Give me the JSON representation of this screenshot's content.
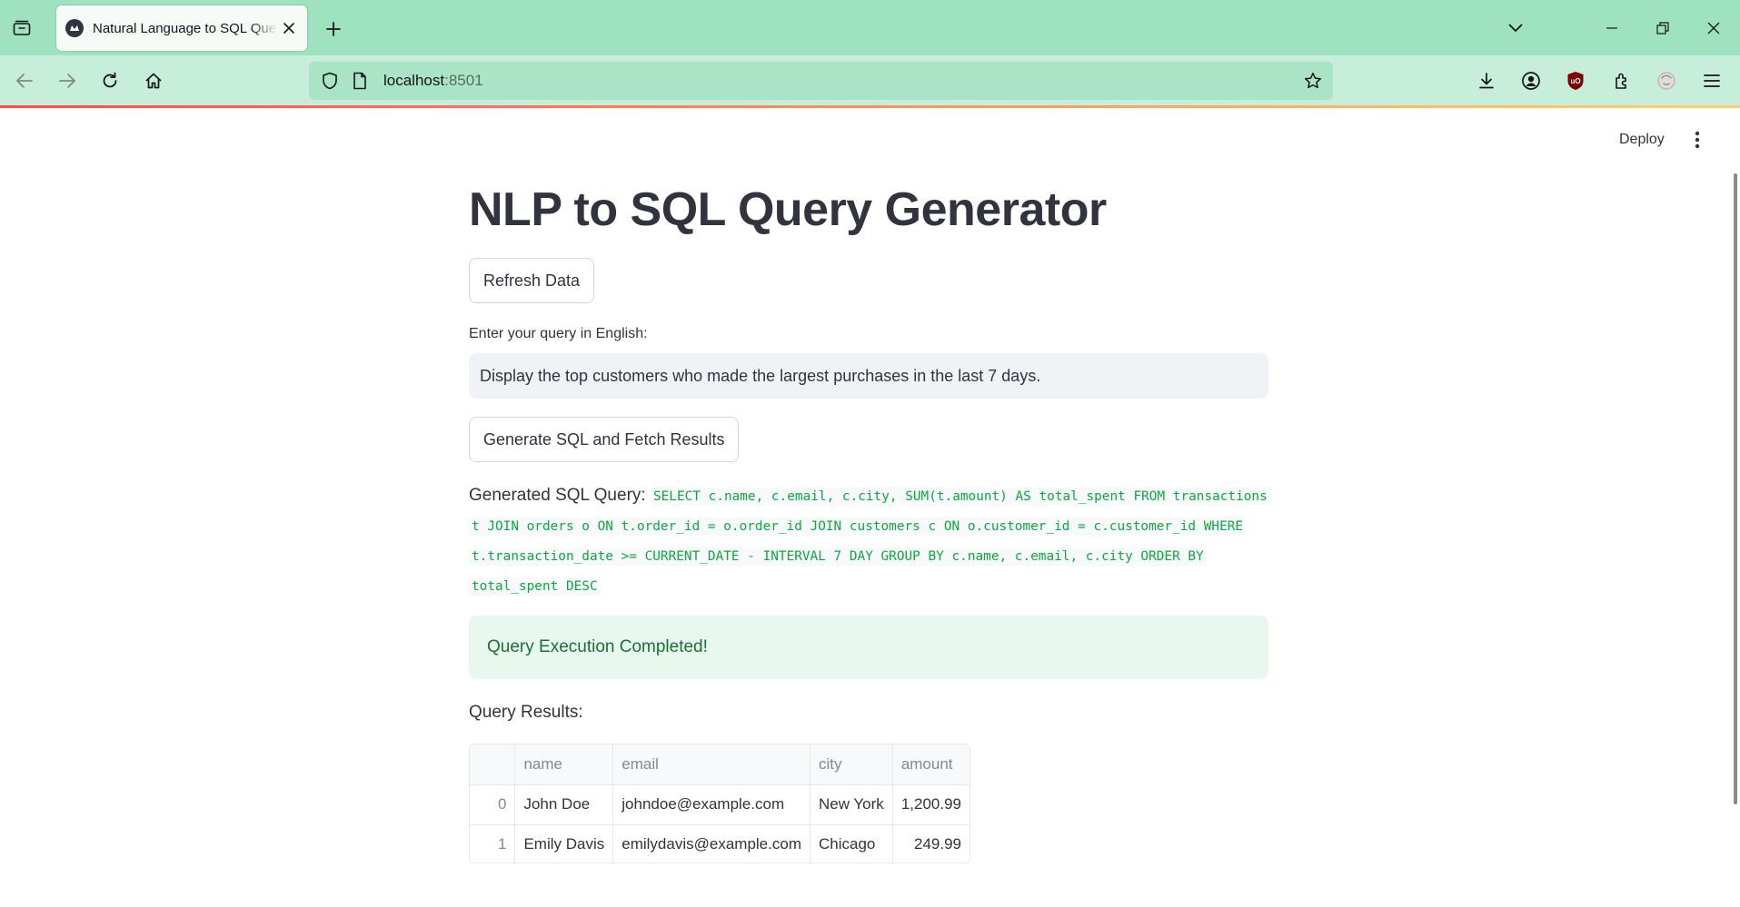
{
  "browser": {
    "tab": {
      "title": "Natural Language to SQL Query Generator"
    },
    "url": {
      "host": "localhost",
      "port": ":8501"
    }
  },
  "app": {
    "deploy_label": "Deploy",
    "title": "NLP to SQL Query Generator",
    "refresh_label": "Refresh Data",
    "input_label": "Enter your query in English:",
    "query_value": "Display the top customers who made the largest purchases in the last 7 days.",
    "generate_label": "Generate SQL and Fetch Results",
    "sql_label": "Generated SQL Query:",
    "sql_text": "SELECT c.name, c.email, c.city, SUM(t.amount) AS total_spent FROM transactions t JOIN orders o ON t.order_id = o.order_id JOIN customers c ON o.customer_id = c.customer_id WHERE t.transaction_date >= CURRENT_DATE - INTERVAL 7 DAY GROUP BY c.name, c.email, c.city ORDER BY total_spent DESC",
    "success_message": "Query Execution Completed!",
    "results_label": "Query Results:",
    "results": {
      "columns": [
        "",
        "name",
        "email",
        "city",
        "amount"
      ],
      "rows": [
        {
          "index": "0",
          "name": "John Doe",
          "email": "johndoe@example.com",
          "city": "New York",
          "amount": "1,200.99"
        },
        {
          "index": "1",
          "name": "Emily Davis",
          "email": "emilydavis@example.com",
          "city": "Chicago",
          "amount": "249.99"
        }
      ]
    }
  },
  "colors": {
    "tabbar": "#9fe2c0",
    "navbar": "#c6eedb",
    "sql_code": "#09ab3b",
    "success_bg": "#e8f8ee",
    "success_text": "#177233"
  },
  "icons": [
    "tab-list-icon",
    "streamlit-favicon-icon",
    "close-icon",
    "plus-icon",
    "chevron-down-icon",
    "minimize-icon",
    "restore-icon",
    "window-close-icon",
    "back-arrow-icon",
    "forward-arrow-icon",
    "reload-icon",
    "home-icon",
    "shield-icon",
    "page-icon",
    "star-icon",
    "download-icon",
    "account-icon",
    "ublock-icon",
    "extensions-icon",
    "profile-icon",
    "menu-icon",
    "kebab-menu-icon"
  ]
}
